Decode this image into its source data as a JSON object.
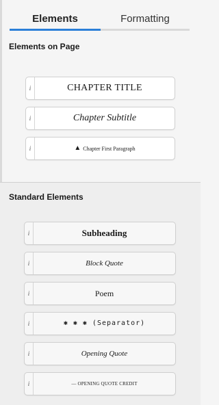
{
  "tabs": {
    "elements": "Elements",
    "formatting": "Formatting"
  },
  "sections": {
    "on_page": "Elements on Page",
    "standard": "Standard Elements"
  },
  "info_glyph": "i",
  "on_page_items": [
    {
      "label": "CHAPTER TITLE"
    },
    {
      "label": "Chapter Subtitle"
    },
    {
      "icon": "drop-cap-icon",
      "label": "Chapter First Paragraph"
    }
  ],
  "standard_items": [
    {
      "label": "Subheading"
    },
    {
      "label": "Block Quote"
    },
    {
      "label": "Poem"
    },
    {
      "label": "✱ ✱ ✱  (Separator)"
    },
    {
      "label": "Opening Quote"
    },
    {
      "label": "— OPENING QUOTE CREDIT"
    }
  ],
  "colors": {
    "accent": "#2b7fd8",
    "background": "#f5f5f5"
  }
}
